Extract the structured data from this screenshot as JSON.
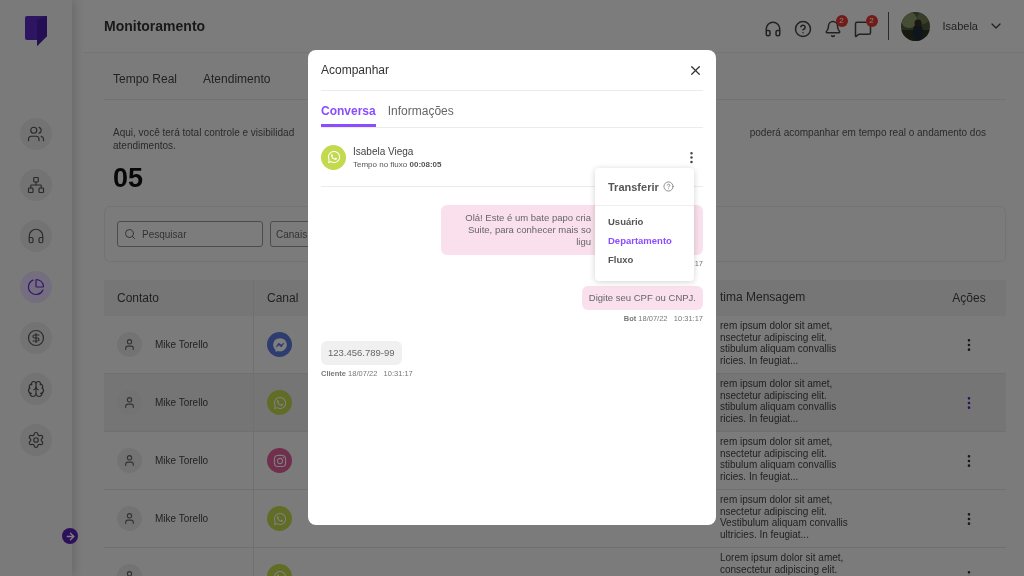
{
  "sidebar": {
    "items": [
      {
        "selected": false
      },
      {
        "selected": false
      },
      {
        "selected": false
      },
      {
        "selected": true
      },
      {
        "selected": false
      },
      {
        "selected": false
      },
      {
        "selected": false
      }
    ]
  },
  "header": {
    "title": "Monitoramento",
    "notifications": "2",
    "messages": "2",
    "user": "Isabela"
  },
  "tabs": [
    {
      "label": "Tempo Real",
      "selected": false
    },
    {
      "label": "Atendimento",
      "selected": false
    }
  ],
  "description": {
    "left": "Aqui, você terá total controle e visibilidad",
    "right": "poderá acompanhar em tempo real o andamento dos",
    "line_2": "atendimentos."
  },
  "count": "05",
  "filters": {
    "search_placeholder": "Pesquisar",
    "channels": "Canais"
  },
  "table": {
    "columns": [
      "Contato",
      "Canal",
      "tima Mensagem",
      "Ações"
    ],
    "rows": [
      {
        "contact": "Mike Torello",
        "kind": "messenger",
        "selected": false,
        "message": [
          "rem ipsum dolor sit amet,",
          "nsectetur adipiscing elit.",
          "stibulum aliquam convallis",
          "ricies. In feugiat..."
        ]
      },
      {
        "contact": "Mike Torello",
        "kind": "whatsapp",
        "selected": true,
        "message": [
          "rem ipsum dolor sit amet,",
          "nsectetur adipiscing elit.",
          "stibulum aliquam convallis",
          "ricies. In feugiat..."
        ]
      },
      {
        "contact": "Mike Torello",
        "kind": "instagram",
        "selected": false,
        "message": [
          "rem ipsum dolor sit amet,",
          "nsectetur adipiscing elit.",
          "stibulum aliquam convallis",
          "ricies. In feugiat..."
        ]
      },
      {
        "contact": "Mike Torello",
        "kind": "whatsapp",
        "selected": false,
        "message": [
          "rem ipsum dolor sit amet,",
          "nsectetur adipiscing elit.",
          "Vestibulum aliquam convallis",
          "ultricies. In feugiat..."
        ]
      },
      {
        "kind": "whatsapp",
        "selected": false,
        "message": [
          "Lorem ipsum dolor sit amet,",
          "consectetur adipiscing elit."
        ]
      }
    ]
  },
  "modal": {
    "title": "Acompanhar",
    "tabs": [
      {
        "label": "Conversa",
        "selected": true
      },
      {
        "label": "Informações",
        "selected": false
      }
    ],
    "contact": {
      "name": "Isabela Viega",
      "kind": "whatsapp",
      "duration": "Tempo no fluxo **00:08:05**"
    },
    "menu": {
      "title": "Transferir",
      "items": [
        {
          "label": "Usuário",
          "selected": false
        },
        {
          "label": "Departamento",
          "selected": true
        },
        {
          "label": "Fluxo",
          "selected": false
        }
      ]
    },
    "messages": [
      {
        "kind": "bot",
        "covered": true,
        "lines": [
          "Olá! Este é um bate papo cria",
          "Suite, para conhecer mais so",
          "ligu"
        ],
        "time": "17"
      },
      {
        "kind": "bot",
        "covered": false,
        "lines": [
          "Digite seu CPF ou CNPJ."
        ],
        "sender": "Bot",
        "date": "18/07/22",
        "time": "10:31:17"
      },
      {
        "kind": "client",
        "covered": false,
        "lines": [
          "123.456.789-99"
        ],
        "sender": "Cliente",
        "date": "18/07/22",
        "time": "10:31:17"
      }
    ]
  }
}
